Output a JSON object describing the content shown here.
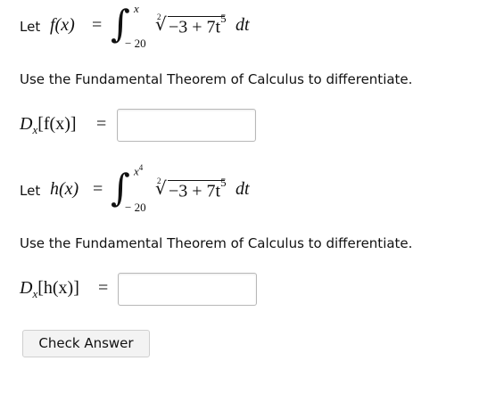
{
  "problem1": {
    "let_label": "Let",
    "func_lhs": "f(x)",
    "equals": "=",
    "upper_limit": "x",
    "lower_limit": "− 20",
    "root_index": "2",
    "radicand": "−3 + 7t",
    "exponent": "5",
    "differential": "dt",
    "instruction": "Use the Fundamental Theorem of Calculus to differentiate.",
    "derivative_lhs": "D",
    "derivative_sub": "x",
    "derivative_arg": "[f(x)]",
    "answer_value": ""
  },
  "problem2": {
    "let_label": "Let",
    "func_lhs": "h(x)",
    "equals": "=",
    "upper_limit_base": "x",
    "upper_limit_exp": "4",
    "lower_limit": "− 20",
    "root_index": "2",
    "radicand": "−3 + 7t",
    "exponent": "5",
    "differential": "dt",
    "instruction": "Use the Fundamental Theorem of Calculus to differentiate.",
    "derivative_lhs": "D",
    "derivative_sub": "x",
    "derivative_arg": "[h(x)]",
    "answer_value": ""
  },
  "check_button_label": "Check Answer"
}
